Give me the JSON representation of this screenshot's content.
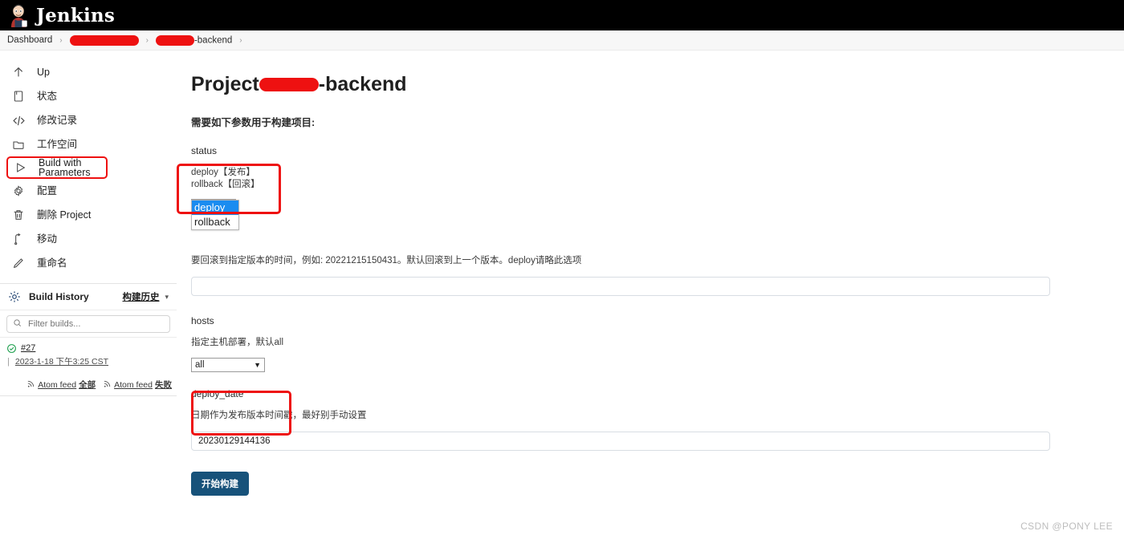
{
  "header": {
    "brand": "Jenkins",
    "logo_icon": "jenkins-butler-icon"
  },
  "breadcrumb": {
    "items": [
      {
        "label": "Dashboard",
        "redacted": false
      },
      {
        "label": "",
        "redacted": true
      },
      {
        "label": "-backend",
        "redacted": true
      }
    ],
    "separator": "›"
  },
  "sidebar": {
    "items": [
      {
        "label": "Up",
        "icon": "arrow-up-icon",
        "highlighted": false
      },
      {
        "label": "状态",
        "icon": "document-icon",
        "highlighted": false
      },
      {
        "label": "修改记录",
        "icon": "code-brackets-icon",
        "highlighted": false
      },
      {
        "label": "工作空间",
        "icon": "folder-icon",
        "highlighted": false
      },
      {
        "label": "Build with Parameters",
        "icon": "play-triangle-icon",
        "highlighted": true
      },
      {
        "label": "配置",
        "icon": "gear-icon",
        "highlighted": false
      },
      {
        "label": "删除 Project",
        "icon": "trash-icon",
        "highlighted": false
      },
      {
        "label": "移动",
        "icon": "move-icon",
        "highlighted": false
      },
      {
        "label": "重命名",
        "icon": "pencil-icon",
        "highlighted": false
      }
    ],
    "build_history": {
      "title": "Build History",
      "icon": "build-history-icon",
      "link_label": "构建历史",
      "chevron_icon": "chevron-down-icon",
      "filter_placeholder": "Filter builds...",
      "filter_icon": "search-icon",
      "builds": [
        {
          "number": "#27",
          "status": "success",
          "status_icon": "check-circle-icon",
          "status_color": "#1a9e4b",
          "date": "2023-1-18 下午3:25 CST"
        }
      ],
      "feeds": [
        {
          "label": "Atom feed",
          "suffix": "全部",
          "icon": "rss-icon"
        },
        {
          "label": "Atom feed",
          "suffix": "失败",
          "icon": "rss-icon"
        }
      ]
    }
  },
  "main": {
    "title_prefix": "Project",
    "title_suffix": "-backend",
    "intro": "需要如下参数用于构建项目:",
    "parameters": [
      {
        "name": "status",
        "description_lines": [
          "deploy【发布】",
          "rollback【回滚】"
        ],
        "control": "select-open",
        "value": "deploy",
        "options": [
          "deploy",
          "rollback"
        ],
        "selected_option": "deploy"
      },
      {
        "name": "",
        "description_lines": [
          "要回滚到指定版本的时间，例如: 20221215150431。默认回滚到上一个版本。deploy请略此选项"
        ],
        "control": "text",
        "value": "",
        "placeholder": ""
      },
      {
        "name": "hosts",
        "description_lines": [
          "指定主机部署，默认all"
        ],
        "control": "select",
        "value": "all",
        "options": [
          "all"
        ]
      },
      {
        "name": "deploy_date",
        "description_lines": [
          "日期作为发布版本时间戳，最好别手动设置"
        ],
        "control": "text",
        "value": "20230129144136",
        "placeholder": ""
      }
    ],
    "submit_label": "开始构建"
  },
  "watermark": "CSDN @PONY LEE",
  "colors": {
    "annotation": "#ee1111",
    "redaction": "#ee1111",
    "dropdown_highlight": "#1a8cf0",
    "button": "#17527a",
    "success": "#1a9e4b"
  }
}
